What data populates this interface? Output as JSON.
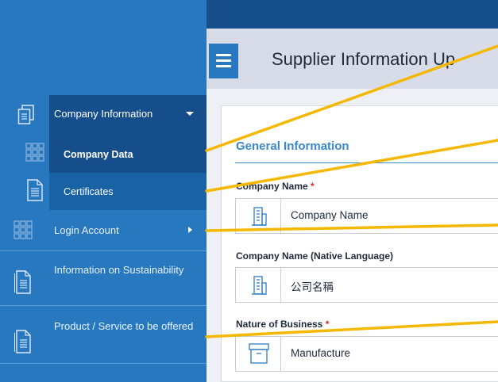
{
  "sidebar": {
    "items": [
      {
        "label": "Company Information",
        "icon": "document-copy-icon",
        "expanded": true
      },
      {
        "label": "Company Data",
        "icon": "grid-icon",
        "active": true
      },
      {
        "label": "Certificates",
        "icon": "document-icon"
      },
      {
        "label": "Login Account",
        "icon": "grid-icon"
      },
      {
        "label": "Information on Sustainability",
        "icon": "document-icon"
      },
      {
        "label": "Product / Service to be offered",
        "icon": "document-icon"
      }
    ]
  },
  "header": {
    "title": "Supplier Information Up"
  },
  "form": {
    "section_title": "General Information",
    "fields": [
      {
        "label": "Company Name",
        "required": "*",
        "value": "Company Name",
        "icon": "building-icon"
      },
      {
        "label": "Company Name (Native Language)",
        "value": "公司名稱",
        "icon": "building-icon"
      },
      {
        "label": "Nature of Business",
        "required": "*",
        "value": "Manufacture",
        "icon": "box-icon"
      }
    ]
  },
  "colors": {
    "sidebar": "#2778bf",
    "sidebar_active": "#154e8a",
    "accent": "#3a87cc",
    "overlay_line": "#f5b800",
    "required": "#d9262b"
  }
}
